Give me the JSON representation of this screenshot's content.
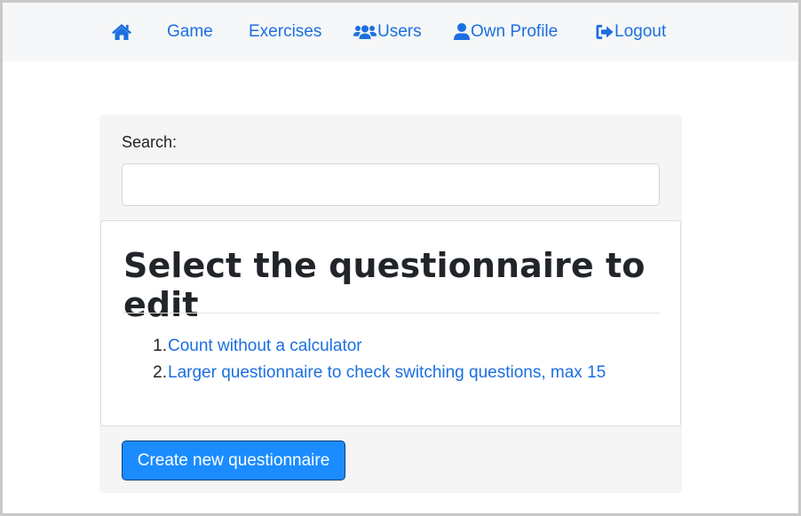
{
  "nav": {
    "home_icon": "home-icon",
    "game": "Game",
    "exercises": "Exercises",
    "users": "Users",
    "users_icon": "users-icon",
    "profile": "Own Profile",
    "profile_icon": "user-icon",
    "logout": "Logout",
    "logout_icon": "sign-out-icon",
    "link_color": "#1b6fe0"
  },
  "search": {
    "label": "Search:",
    "value": "",
    "placeholder": ""
  },
  "panel": {
    "title": "Select the questionnaire to edit",
    "items": [
      {
        "number": "1.",
        "label": "Count without a calculator"
      },
      {
        "number": "2.",
        "label": "Larger questionnaire to check switching questions, max 15"
      }
    ]
  },
  "actions": {
    "create_label": "Create new questionnaire",
    "button_color": "#1a8cff"
  }
}
